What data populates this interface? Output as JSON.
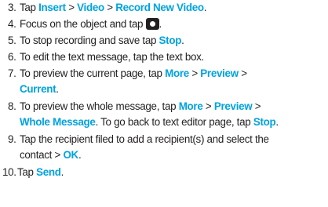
{
  "steps": [
    {
      "num": "3.",
      "parts": [
        "Tap ",
        "Insert",
        " > ",
        "Video",
        " > ",
        "Record New Video",
        "."
      ]
    },
    {
      "num": "4.",
      "parts": [
        "Focus on the object and tap ",
        "."
      ]
    },
    {
      "num": "5.",
      "parts": [
        "To stop recording and save tap ",
        "Stop",
        "."
      ]
    },
    {
      "num": "6.",
      "parts": [
        "To edit the text message, tap the text box."
      ]
    },
    {
      "num": "7.",
      "parts": [
        "To preview the current page, tap ",
        "More",
        " > ",
        "Preview",
        " >",
        "Current",
        "."
      ]
    },
    {
      "num": "8.",
      "parts": [
        "To preview the whole message, tap ",
        "More",
        " > ",
        "Preview",
        " >",
        "Whole Message",
        ". To go back to text editor page, tap ",
        "Stop",
        "."
      ]
    },
    {
      "num": "9.",
      "parts": [
        "Tap the recipient filed to add a recipient(s) and select the",
        "contact > ",
        "OK",
        "."
      ]
    },
    {
      "num": "10.",
      "parts": [
        "Tap ",
        "Send",
        "."
      ]
    }
  ],
  "icons": {
    "record": "camera-shutter-icon"
  },
  "colors": {
    "highlight": "#00a2e0",
    "text": "#231f20"
  }
}
